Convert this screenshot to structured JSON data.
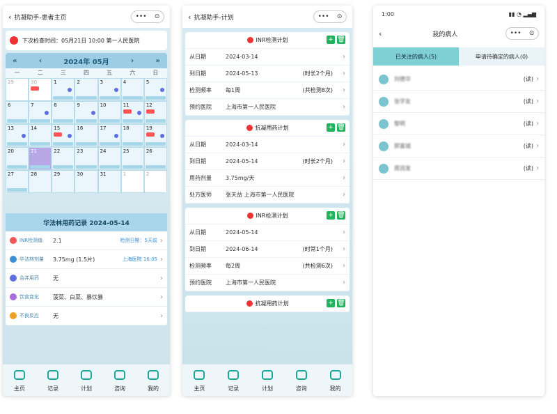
{
  "p1": {
    "title": "抗凝助手-患者主页",
    "reminder": "下次检查时间：05月21日 10:00   第一人民医院",
    "month": "2024年 05月",
    "weekdays": [
      "一",
      "二",
      "三",
      "四",
      "五",
      "六",
      "日"
    ],
    "days": [
      "29",
      "30",
      "1",
      "2",
      "3",
      "4",
      "5",
      "6",
      "7",
      "8",
      "9",
      "10",
      "11",
      "12",
      "13",
      "14",
      "15",
      "16",
      "17",
      "18",
      "19",
      "20",
      "21",
      "22",
      "23",
      "24",
      "25",
      "26",
      "27",
      "28",
      "29",
      "30",
      "31",
      "1",
      "2"
    ],
    "record_title": "华法林用药记录 2024-05-14",
    "rows": [
      {
        "label": "INR检测值",
        "value": "2.1",
        "extra": "检测日期：5天前",
        "color": "#e55"
      },
      {
        "label": "华法林剂量",
        "value": "3.75mg (1.5片)",
        "extra": "上海医院  16:05",
        "color": "#3a8fd6"
      },
      {
        "label": "合并用药",
        "value": "无",
        "extra": "",
        "color": "#5d6fe0"
      },
      {
        "label": "饮食变化",
        "value": "菠菜、白菜、暴饮暴",
        "extra": "",
        "color": "#a96de0"
      },
      {
        "label": "不良反应",
        "value": "无",
        "extra": "",
        "color": "#f0a020"
      }
    ],
    "tabs": [
      "主页",
      "记录",
      "计划",
      "咨询",
      "我的"
    ]
  },
  "p2": {
    "title": "抗凝助手-计划",
    "cards": [
      {
        "head": "INR检测计划",
        "rows": [
          [
            "从日期",
            "2024-03-14",
            ""
          ],
          [
            "到日期",
            "2024-05-13",
            "(时长2个月)"
          ],
          [
            "检测频率",
            "每1周",
            "(共检测8次)"
          ],
          [
            "预约医院",
            "上海市第一人民医院",
            ""
          ]
        ]
      },
      {
        "head": "抗凝用药计划",
        "rows": [
          [
            "从日期",
            "2024-03-14",
            ""
          ],
          [
            "到日期",
            "2024-05-14",
            "(时长2个月)"
          ],
          [
            "用药剂量",
            "3.75mg/天",
            ""
          ],
          [
            "处方医师",
            "张天益   上海市第一人民医院",
            ""
          ]
        ]
      },
      {
        "head": "INR检测计划",
        "rows": [
          [
            "从日期",
            "2024-05-14",
            ""
          ],
          [
            "到日期",
            "2024-06-14",
            "(时常1个月)"
          ],
          [
            "检测频率",
            "每2周",
            "(共检测6次)"
          ],
          [
            "预约医院",
            "上海市第一人民医院",
            ""
          ]
        ]
      },
      {
        "head": "抗凝用药计划",
        "rows": []
      }
    ],
    "tabs": [
      "主页",
      "记录",
      "计划",
      "咨询",
      "我的"
    ]
  },
  "p3": {
    "time": "1:00",
    "title": "我的病人",
    "seg_on": "已关注的病人(5)",
    "seg_off": "申请待确定的病人(0)",
    "patients": [
      "刘德华",
      "张学友",
      "黎明",
      "郭富城",
      "周润发"
    ],
    "state": "(读)"
  }
}
